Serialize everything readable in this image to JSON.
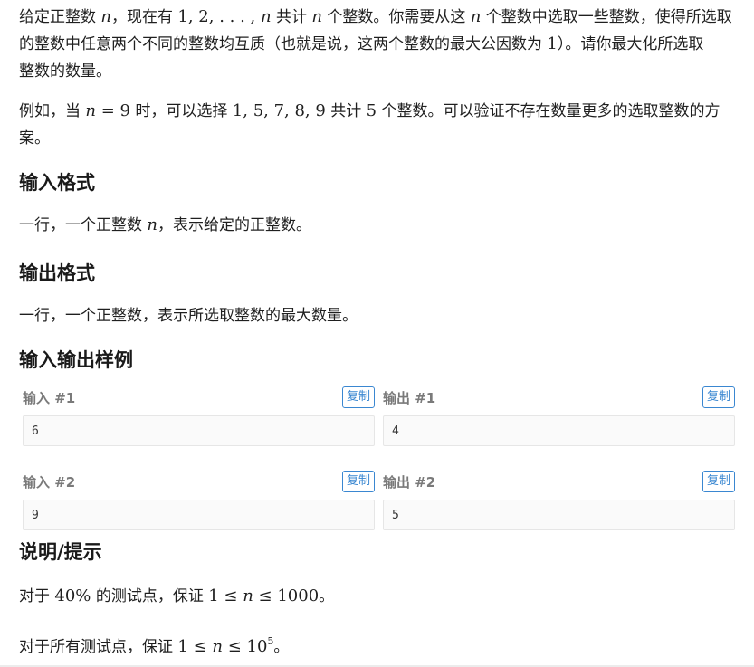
{
  "description": {
    "p1": {
      "text_a": "给定正整数 ",
      "n1": "n",
      "text_b": "，现在有 ",
      "seq": "1, 2, . . . , ",
      "n2": "n",
      "text_c": " 共计 ",
      "n3": "n",
      "text_d": " 个整数。你需要从这 ",
      "n4": "n",
      "text_e": " 个整数中选取一些整数，使得所选取",
      "line2": "的整数中任意两个不同的整数均互质（也就是说，这两个整数的最大公因数为 ",
      "one": "1",
      "line2_end": "）。请你最大化所选取",
      "line3": "整数的数量。"
    },
    "p2": {
      "text_a": "例如，当 ",
      "n": "n",
      "eq": " = 9",
      "text_b": " 时，可以选择 ",
      "nums": "1, 5, 7, 8, 9",
      "text_c": " 共计 ",
      "five": "5",
      "text_d": " 个整数。可以验证不存在数量更多的选取整数的方",
      "line2": "案。"
    }
  },
  "input_format": {
    "title": "输入格式",
    "text_a": "一行，一个正整数 ",
    "n": "n",
    "text_b": "，表示给定的正整数。"
  },
  "output_format": {
    "title": "输出格式",
    "text": "一行，一个正整数，表示所选取整数的最大数量。"
  },
  "samples": {
    "title": "输入输出样例",
    "copy_label": "复制",
    "items": [
      {
        "input_label": "输入 #1",
        "input_value": "6",
        "output_label": "输出 #1",
        "output_value": "4"
      },
      {
        "input_label": "输入 #2",
        "input_value": "9",
        "output_label": "输出 #2",
        "output_value": "5"
      }
    ]
  },
  "hint": {
    "title": "说明/提示",
    "line1": {
      "text_a": "对于 ",
      "pct": "40%",
      "text_b": " 的测试点，保证 ",
      "math": "1 ≤ ",
      "n": "n",
      "math2": " ≤ 1000",
      "end": "。"
    },
    "line2": {
      "text_a": "对于所有测试点，保证 ",
      "math": "1 ≤ ",
      "n": "n",
      "math2": " ≤ 10",
      "exp": "5",
      "end": "。"
    }
  },
  "colors": {
    "accent": "#3a87d1",
    "label_gray": "#7a7a7a",
    "code_bg": "#fafafa"
  }
}
